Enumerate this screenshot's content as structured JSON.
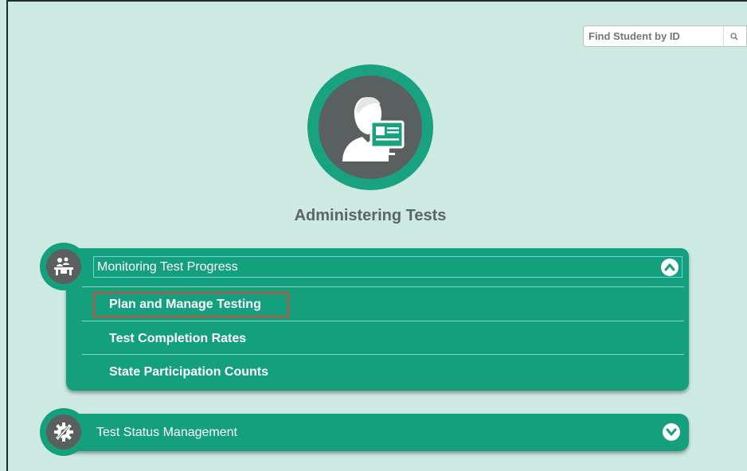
{
  "search": {
    "placeholder": "Find Student by ID",
    "button_icon": "search-icon"
  },
  "hero": {
    "title": "Administering Tests",
    "icon": "test-administrator-icon"
  },
  "panels": [
    {
      "title": "Monitoring Test Progress",
      "icon": "classroom-icon",
      "expanded": true,
      "toggle_icon": "chevron-up-icon",
      "items": [
        {
          "label": "Plan and Manage Testing",
          "highlighted": true
        },
        {
          "label": "Test Completion Rates"
        },
        {
          "label": "State Participation Counts"
        }
      ]
    },
    {
      "title": "Test Status Management",
      "icon": "gear-wrench-icon",
      "expanded": false,
      "toggle_icon": "chevron-down-icon"
    }
  ],
  "colors": {
    "background": "#cdeae2",
    "accent_green": "#14a07c",
    "icon_gray": "#5a5f60",
    "highlight_red": "#d9453a"
  }
}
